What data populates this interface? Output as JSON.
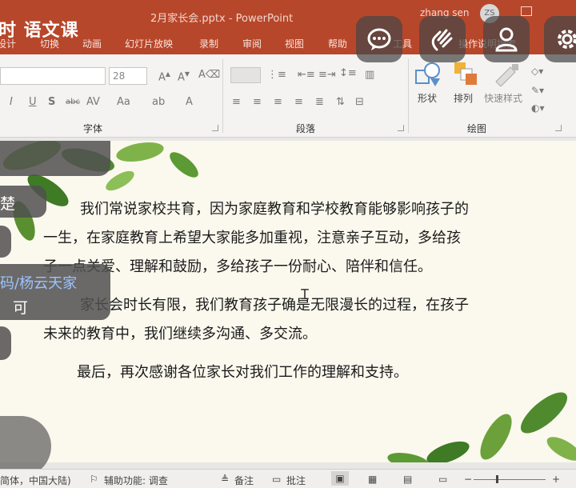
{
  "window": {
    "title": "2月家长会.pptx  -  PowerPoint",
    "course_title": "时 语文课",
    "user_name": "zhang sen",
    "user_initials": "ZS"
  },
  "ribbon_tabs": [
    "设计",
    "切换",
    "动画",
    "幻灯片放映",
    "录制",
    "审阅",
    "视图",
    "帮助",
    "工具",
    "操作说明搜索"
  ],
  "ribbon": {
    "font_size": "28",
    "font_group_label": "字体",
    "paragraph_group_label": "段落",
    "drawing_group_label": "绘图",
    "shape_label": "形状",
    "arrange_label": "排列",
    "quick_style_label": "快速样式"
  },
  "overlay_buttons": [
    "chat-bubble-icon",
    "hand-wave-icon",
    "person-icon",
    "gear-icon"
  ],
  "slide": {
    "paragraph1": [
      "我们常说家校共育，因为家庭教育和学校教育能够影响孩子的",
      "一生，在家庭教育上希望大家能多加重视，注意亲子互动，多给孩",
      "子一点关爱、理解和鼓励，多给孩子一份耐心、陪伴和信任。"
    ],
    "paragraph2": [
      "家长会时长有限，我们教育孩子确是无限漫长的过程，在孩子",
      "未来的教育中，我们继续多沟通、多交流。"
    ],
    "paragraph3": "最后，再次感谢各位家长对我们工作的理解和支持。"
  },
  "side_overlay": {
    "text1": "楚",
    "text2": "码/杨云天家",
    "text3": "可"
  },
  "status_bar": {
    "language": "简体，中国大陆)",
    "accessibility": "辅助功能: 调查",
    "notes": "备注",
    "comments": "批注"
  }
}
